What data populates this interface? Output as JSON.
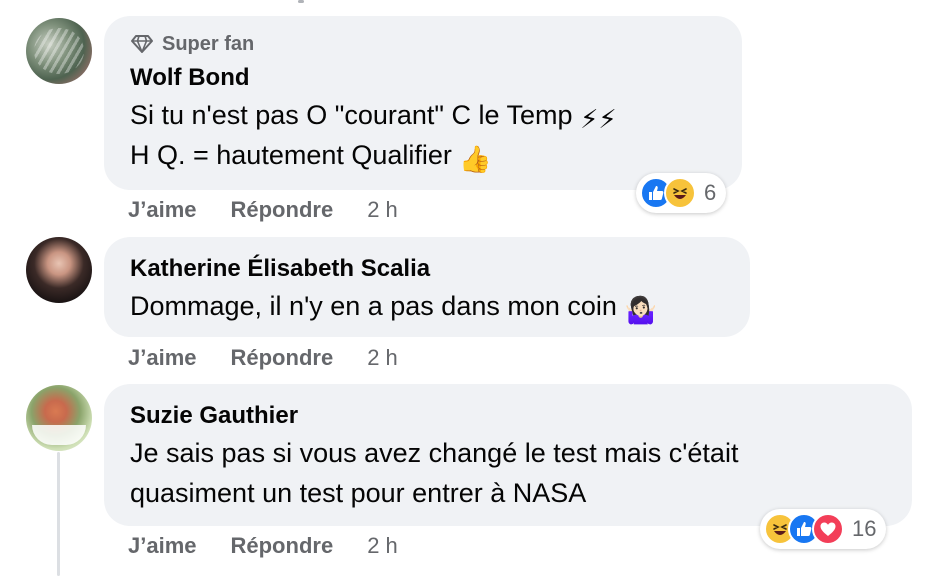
{
  "comments": [
    {
      "badge": "Super fan",
      "author": "Wolf Bond",
      "lines": [
        "Si tu n'est pas O \"courant\" C le Temp",
        "H Q. = hautement Qualifier"
      ],
      "line_emojis": [
        "⚡⚡",
        "👍"
      ],
      "like_label": "J’aime",
      "reply_label": "Répondre",
      "time": "2 h",
      "reaction_icons": [
        "like-icon",
        "haha-icon"
      ],
      "reaction_count": "6"
    },
    {
      "author": "Katherine Élisabeth Scalia",
      "lines": [
        "Dommage, il n'y en a pas dans mon coin"
      ],
      "line_emojis": [
        "🤷🏻‍♀️"
      ],
      "like_label": "J’aime",
      "reply_label": "Répondre",
      "time": "2 h"
    },
    {
      "author": "Suzie Gauthier",
      "lines": [
        "Je sais pas si vous avez changé le test mais c'était",
        "quasiment un test pour entrer à NASA"
      ],
      "like_label": "J’aime",
      "reply_label": "Répondre",
      "time": "2 h",
      "reaction_icons": [
        "haha-icon",
        "like-icon",
        "love-icon"
      ],
      "reaction_count": "16"
    }
  ],
  "colors": {
    "bubble": "#f0f2f5",
    "secondary_text": "#65676b",
    "like": "#1877f2",
    "love": "#f33e58",
    "haha": "#f7c33b"
  }
}
